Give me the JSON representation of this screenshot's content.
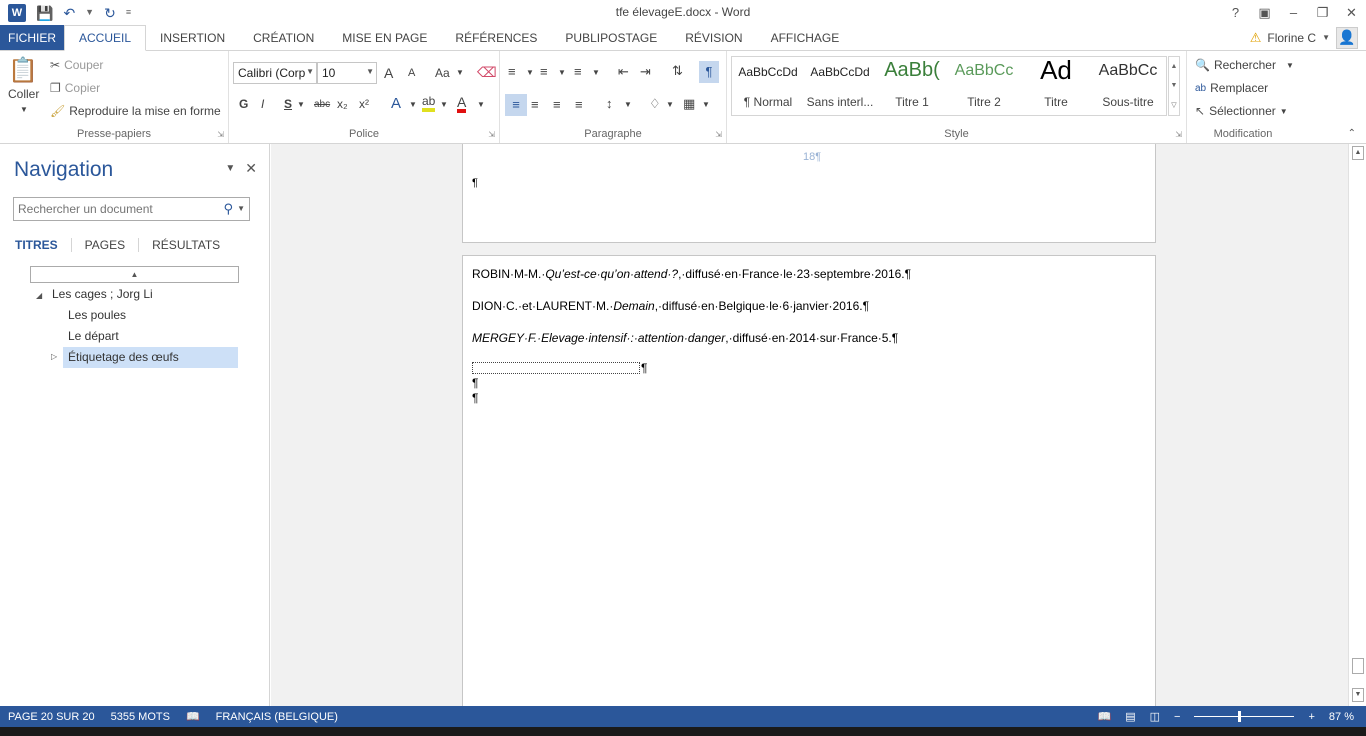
{
  "window": {
    "title": "tfe élevageE.docx - Word",
    "app_logo": "W",
    "controls": [
      "?",
      "▣",
      "–",
      "❐",
      "✕"
    ]
  },
  "tabs": {
    "file": "FICHIER",
    "items": [
      "ACCUEIL",
      "INSERTION",
      "CRÉATION",
      "MISE EN PAGE",
      "RÉFÉRENCES",
      "PUBLIPOSTAGE",
      "RÉVISION",
      "AFFICHAGE"
    ],
    "active": "ACCUEIL"
  },
  "user": {
    "name": "Florine C",
    "warning_icon": "warning-icon",
    "avatar_icon": "person-icon"
  },
  "ribbon": {
    "clipboard": {
      "label": "Presse-papiers",
      "paste": "Coller",
      "cut": "Couper",
      "copy": "Copier",
      "format_painter": "Reproduire la mise en forme"
    },
    "font": {
      "label": "Police",
      "font_name": "Calibri (Corp",
      "font_size": "10",
      "grow": "A",
      "shrink": "A",
      "case": "Aa",
      "bold": "G",
      "italic": "I",
      "underline": "S",
      "strike": "abc",
      "subscript": "x₂",
      "superscript": "x²",
      "effects": "A",
      "highlight": "ab",
      "color": "A"
    },
    "paragraph": {
      "label": "Paragraphe",
      "pilcrow": "¶"
    },
    "styles": {
      "label": "Style",
      "items": [
        {
          "preview": "AaBbCcDd",
          "name": "¶ Normal"
        },
        {
          "preview": "AaBbCcDd",
          "name": "Sans interl..."
        },
        {
          "preview": "AaBb(",
          "name": "Titre 1"
        },
        {
          "preview": "AaBbCc",
          "name": "Titre 2"
        },
        {
          "preview": "Ad",
          "name": "Titre"
        },
        {
          "preview": "AaBbCc",
          "name": "Sous-titre"
        }
      ]
    },
    "editing": {
      "label": "Modification",
      "find": "Rechercher",
      "replace": "Remplacer",
      "select": "Sélectionner"
    }
  },
  "navigation": {
    "title": "Navigation",
    "search_placeholder": "Rechercher un document",
    "tabs": [
      "TITRES",
      "PAGES",
      "RÉSULTATS"
    ],
    "active_tab": "TITRES",
    "tree": [
      {
        "label": "Les cages ; Jorg Li",
        "level": 0,
        "expanded": true
      },
      {
        "label": "Les poules",
        "level": 1
      },
      {
        "label": "Le départ",
        "level": 1
      },
      {
        "label": "Étiquetage des œufs",
        "level": 1,
        "selected": true,
        "collapsed": true
      }
    ]
  },
  "document": {
    "page_top": {
      "page_number": "18¶",
      "pilcrow": "¶"
    },
    "page_bottom": {
      "lines": [
        {
          "pre": "ROBIN·M-M.·",
          "italic": "Qu’est-ce·qu’on·attend·?",
          "post": ",·diffusé·en·France·le·23·septembre·2016.¶"
        },
        {
          "pre": "DION·C.·et·LAURENT·M.·",
          "italic": "Demain",
          "post": ",·diffusé·en·Belgique·le·6·janvier·2016.¶"
        },
        {
          "pre": "",
          "italic": "MERGEY·F.·Elevage·intensif·:·attention·danger",
          "post": ",·diffusé·en·2014·sur·France·5.¶"
        }
      ],
      "after_box": "¶",
      "empty1": "¶",
      "empty2": "¶"
    }
  },
  "status": {
    "page": "PAGE 20 SUR 20",
    "words": "5355 MOTS",
    "language": "FRANÇAIS (BELGIQUE)",
    "zoom": "87 %",
    "zoom_minus": "−",
    "zoom_plus": "+"
  }
}
